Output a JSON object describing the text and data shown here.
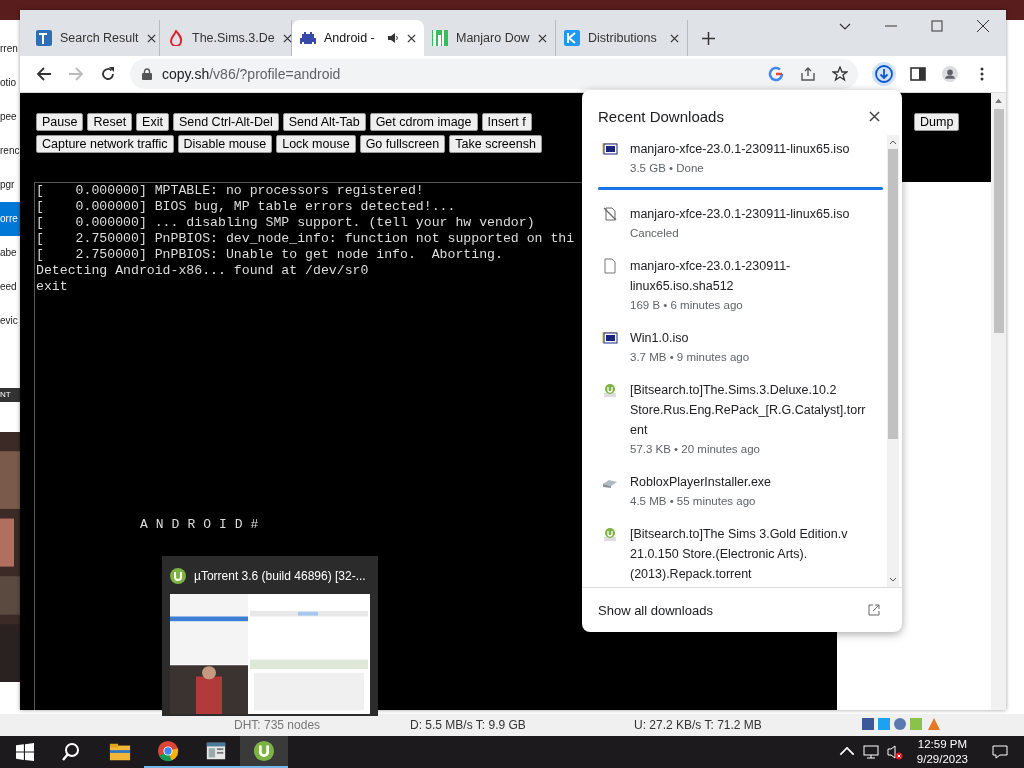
{
  "back_window": {
    "sidebar_items": [
      {
        "label": "rren",
        "selected": false
      },
      {
        "label": "otio",
        "selected": false
      },
      {
        "label": "pee",
        "selected": false
      },
      {
        "label": "renc",
        "selected": false
      },
      {
        "label": "pgr",
        "selected": false
      },
      {
        "label": "orre",
        "selected": true
      },
      {
        "label": "abe",
        "selected": false
      },
      {
        "label": "eed",
        "selected": false
      },
      {
        "label": "evic",
        "selected": false
      }
    ],
    "sidebar_footer": "NT",
    "status_bar": [
      "DHT: 735 nodes",
      "D: 5.5 MB/s T: 9.9 GB",
      "U: 27.2 KB/s T: 71.2 MB"
    ]
  },
  "browser": {
    "tabs": [
      {
        "title": "Search Result",
        "kind": "t2",
        "audio": false,
        "selected": false
      },
      {
        "title": "The.Sims.3.De",
        "kind": "flame",
        "audio": false,
        "selected": false
      },
      {
        "title": "Android -",
        "kind": "invader",
        "audio": true,
        "selected": true
      },
      {
        "title": "Manjaro Dow",
        "kind": "manjaro",
        "audio": false,
        "selected": false
      },
      {
        "title": "Distributions",
        "kind": "kde",
        "audio": false,
        "selected": false
      }
    ],
    "url": {
      "host": "copy.sh",
      "path": "/v86/?profile=android"
    },
    "page": {
      "button_rows": [
        [
          "Pause",
          "Reset",
          "Exit",
          "Send Ctrl-Alt-Del",
          "Send Alt-Tab",
          "Get cdrom image",
          "Insert f"
        ],
        [
          "Capture network traffic",
          "Disable mouse",
          "Lock mouse",
          "Go fullscreen",
          "Take screensh"
        ]
      ],
      "right_button": "Dump",
      "terminal_lines": [
        "[    0.000000] MPTABLE: no processors registered!",
        "[    0.000000] BIOS bug, MP table errors detected!...",
        "[    0.000000] ... disabling SMP support. (tell your hw vendor)",
        "[    2.750000] PnPBIOS: dev_node_info: function not supported on thi",
        "[    2.750000] PnPBIOS: Unable to get node info.  Aborting.",
        "Detecting Android-x86... found at /dev/sr0",
        "exit"
      ],
      "screen_prompt": "ANDROID#"
    },
    "downloads": {
      "title": "Recent Downloads",
      "items": [
        {
          "kind": "iso",
          "name": "manjaro-xfce-23.0.1-230911-linux65.iso",
          "status": "3.5 GB • Done",
          "level": 1
        },
        {
          "kind": "canceled",
          "name": "manjaro-xfce-23.0.1-230911-linux65.iso",
          "status": "Canceled"
        },
        {
          "kind": "file",
          "name": "manjaro-xfce-23.0.1-230911-linux65.iso.sha512",
          "status": "169 B • 6 minutes ago"
        },
        {
          "kind": "iso",
          "name": "Win1.0.iso",
          "status": "3.7 MB • 9 minutes ago"
        },
        {
          "kind": "torrent",
          "name": "[Bitsearch.to]The.Sims.3.Deluxe.10.2 Store.Rus.Eng.RePack_[R.G.Catalyst].torrent",
          "status": "57.3 KB • 20 minutes ago"
        },
        {
          "kind": "exe",
          "name": "RobloxPlayerInstaller.exe",
          "status": "4.5 MB • 55 minutes ago"
        },
        {
          "kind": "torrent",
          "name": "[Bitsearch.to]The Sims 3.Gold Edition.v 21.0.150   Store.(Electronic Arts).(2013).Repack.torrent"
        }
      ],
      "show_all": "Show all downloads"
    }
  },
  "thumbnail": {
    "title": "µTorrent 3.6  (build 46896) [32-..."
  },
  "taskbar": {
    "apps": [
      {
        "kind": "explorer",
        "running": false,
        "selected": false
      },
      {
        "kind": "chrome",
        "running": true,
        "selected": false
      },
      {
        "kind": "window",
        "running": true,
        "selected": false
      },
      {
        "kind": "utorrent",
        "running": true,
        "selected": true
      }
    ],
    "time": "12:59 PM",
    "date": "9/29/2023"
  }
}
